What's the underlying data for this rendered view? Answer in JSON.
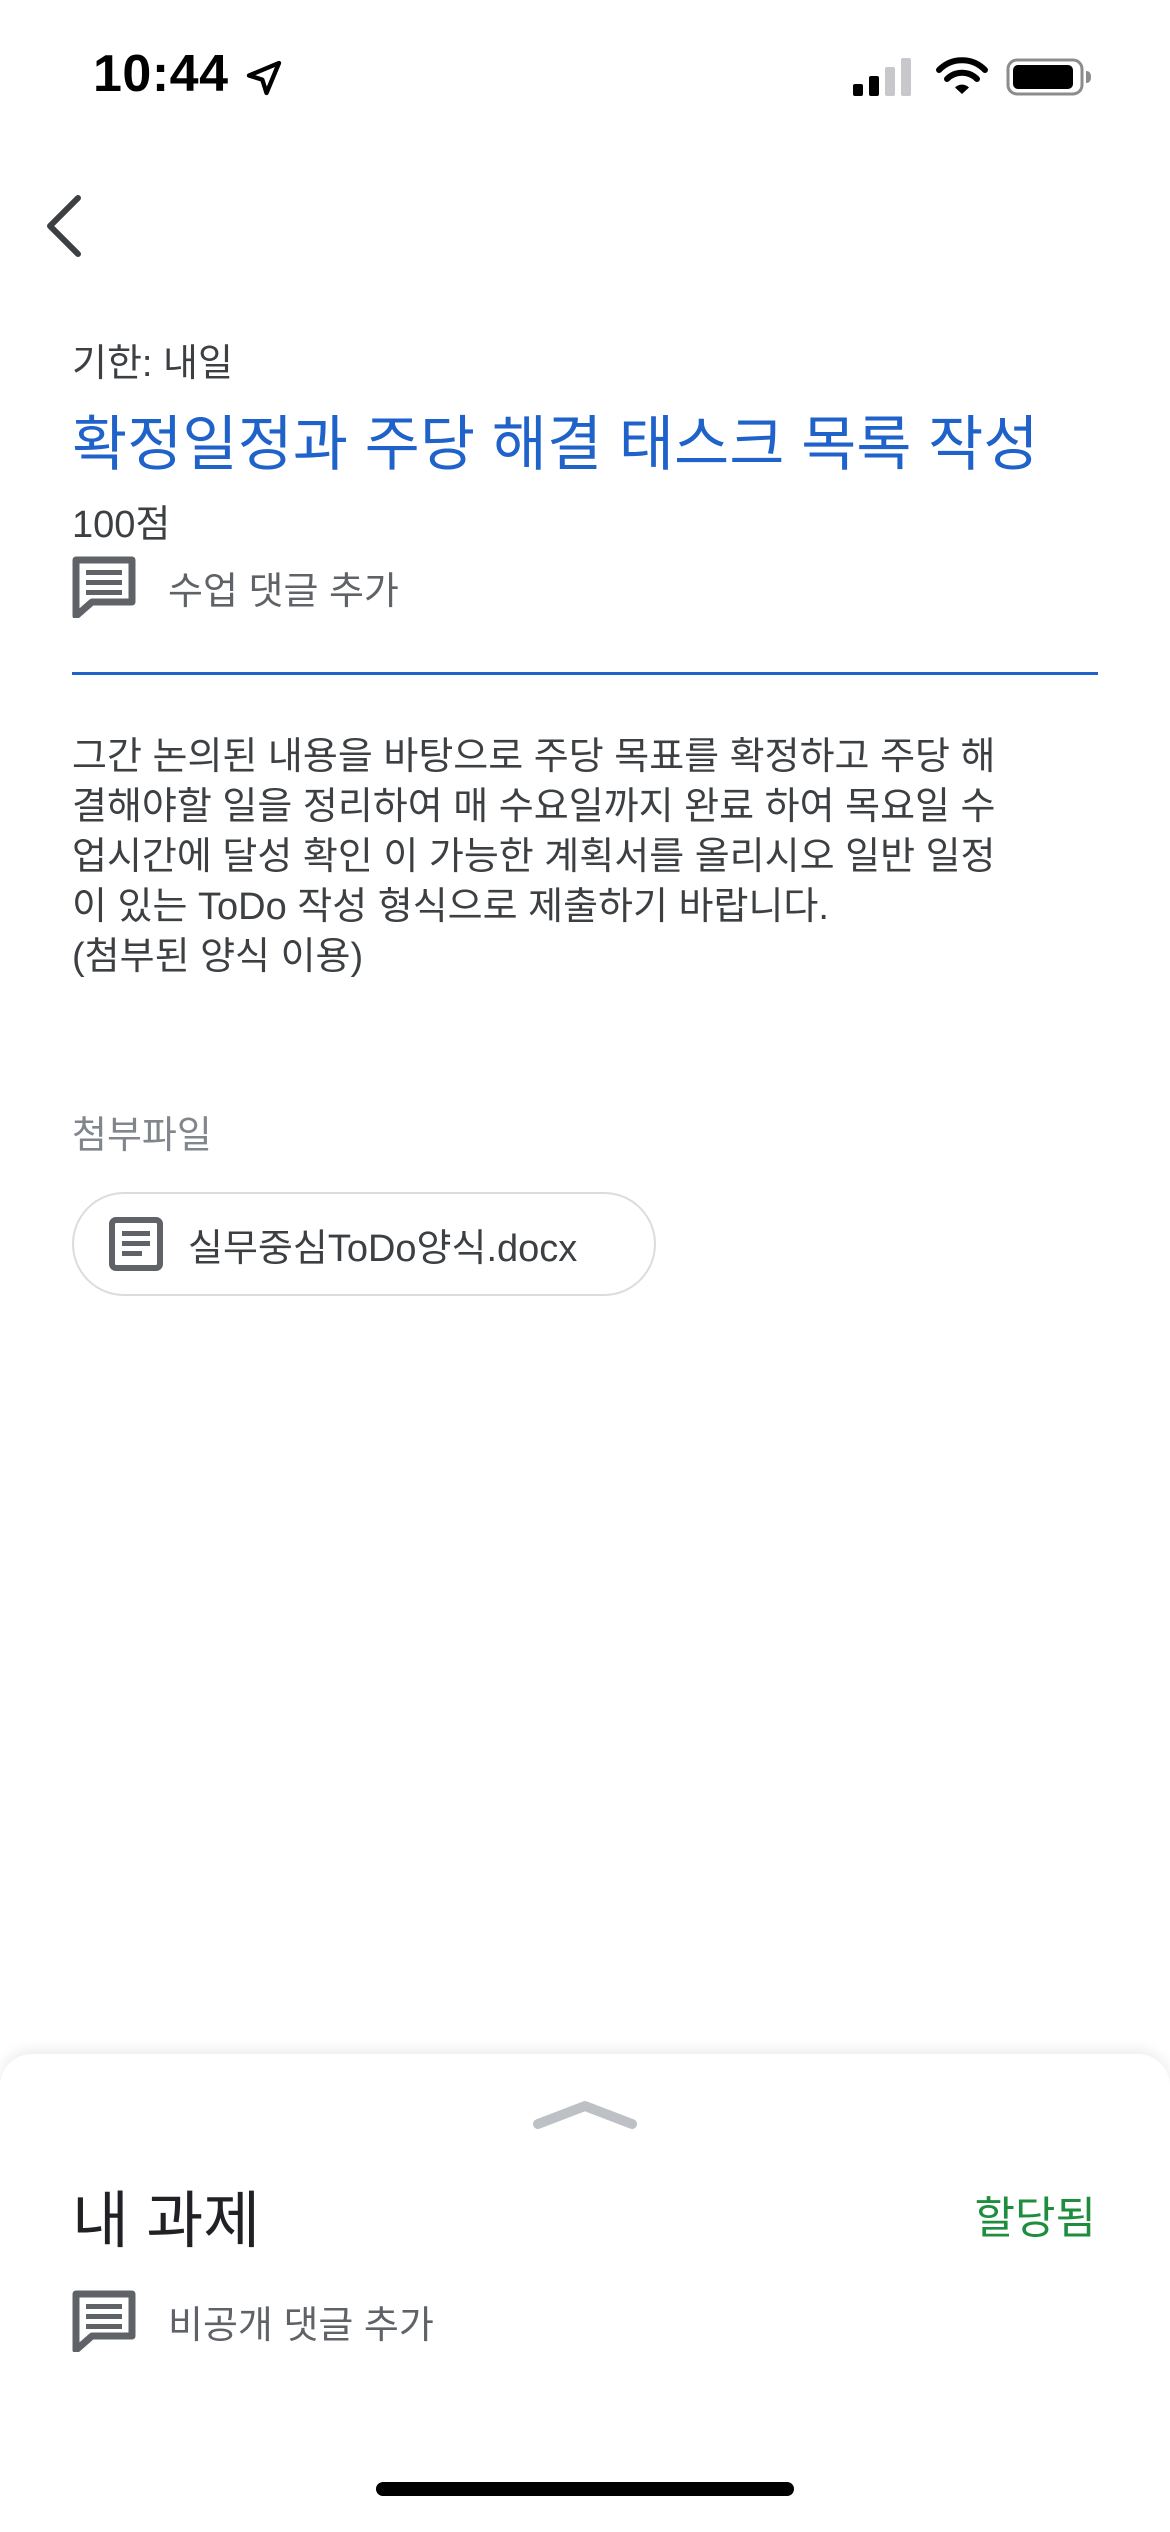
{
  "status_bar": {
    "time": "10:44",
    "icons": [
      "location-arrow-icon",
      "cellular-signal-icon",
      "wifi-icon",
      "battery-icon"
    ]
  },
  "navigation": {
    "back_icon": "chevron-left-icon"
  },
  "assignment": {
    "due": "기한: 내일",
    "title": "확정일정과 주당 해결 태스크 목록 작성",
    "points": "100점",
    "class_comment_label": "수업 댓글 추가",
    "description": "그간 논의된 내용을 바탕으로 주당 목표를 확정하고 주당 해\n결해야할 일을 정리하여 매 수요일까지 완료 하여 목요일 수\n업시간에 달성 확인 이 가능한 계획서를 올리시오 일반 일정\n이 있는 ToDo 작성 형식으로 제출하기 바랍니다.\n(첨부된 양식 이용)",
    "attachments_heading": "첨부파일",
    "attachments": [
      {
        "name": "실무중심ToDo양식.docx",
        "icon": "document-icon"
      }
    ]
  },
  "my_work": {
    "title": "내 과제",
    "status": "할당됨",
    "private_comment_label": "비공개 댓글 추가"
  },
  "colors": {
    "accent_blue": "#1f62c9",
    "status_green": "#1e8e3e",
    "text_primary": "#3c4043",
    "text_secondary": "#5f6368"
  }
}
